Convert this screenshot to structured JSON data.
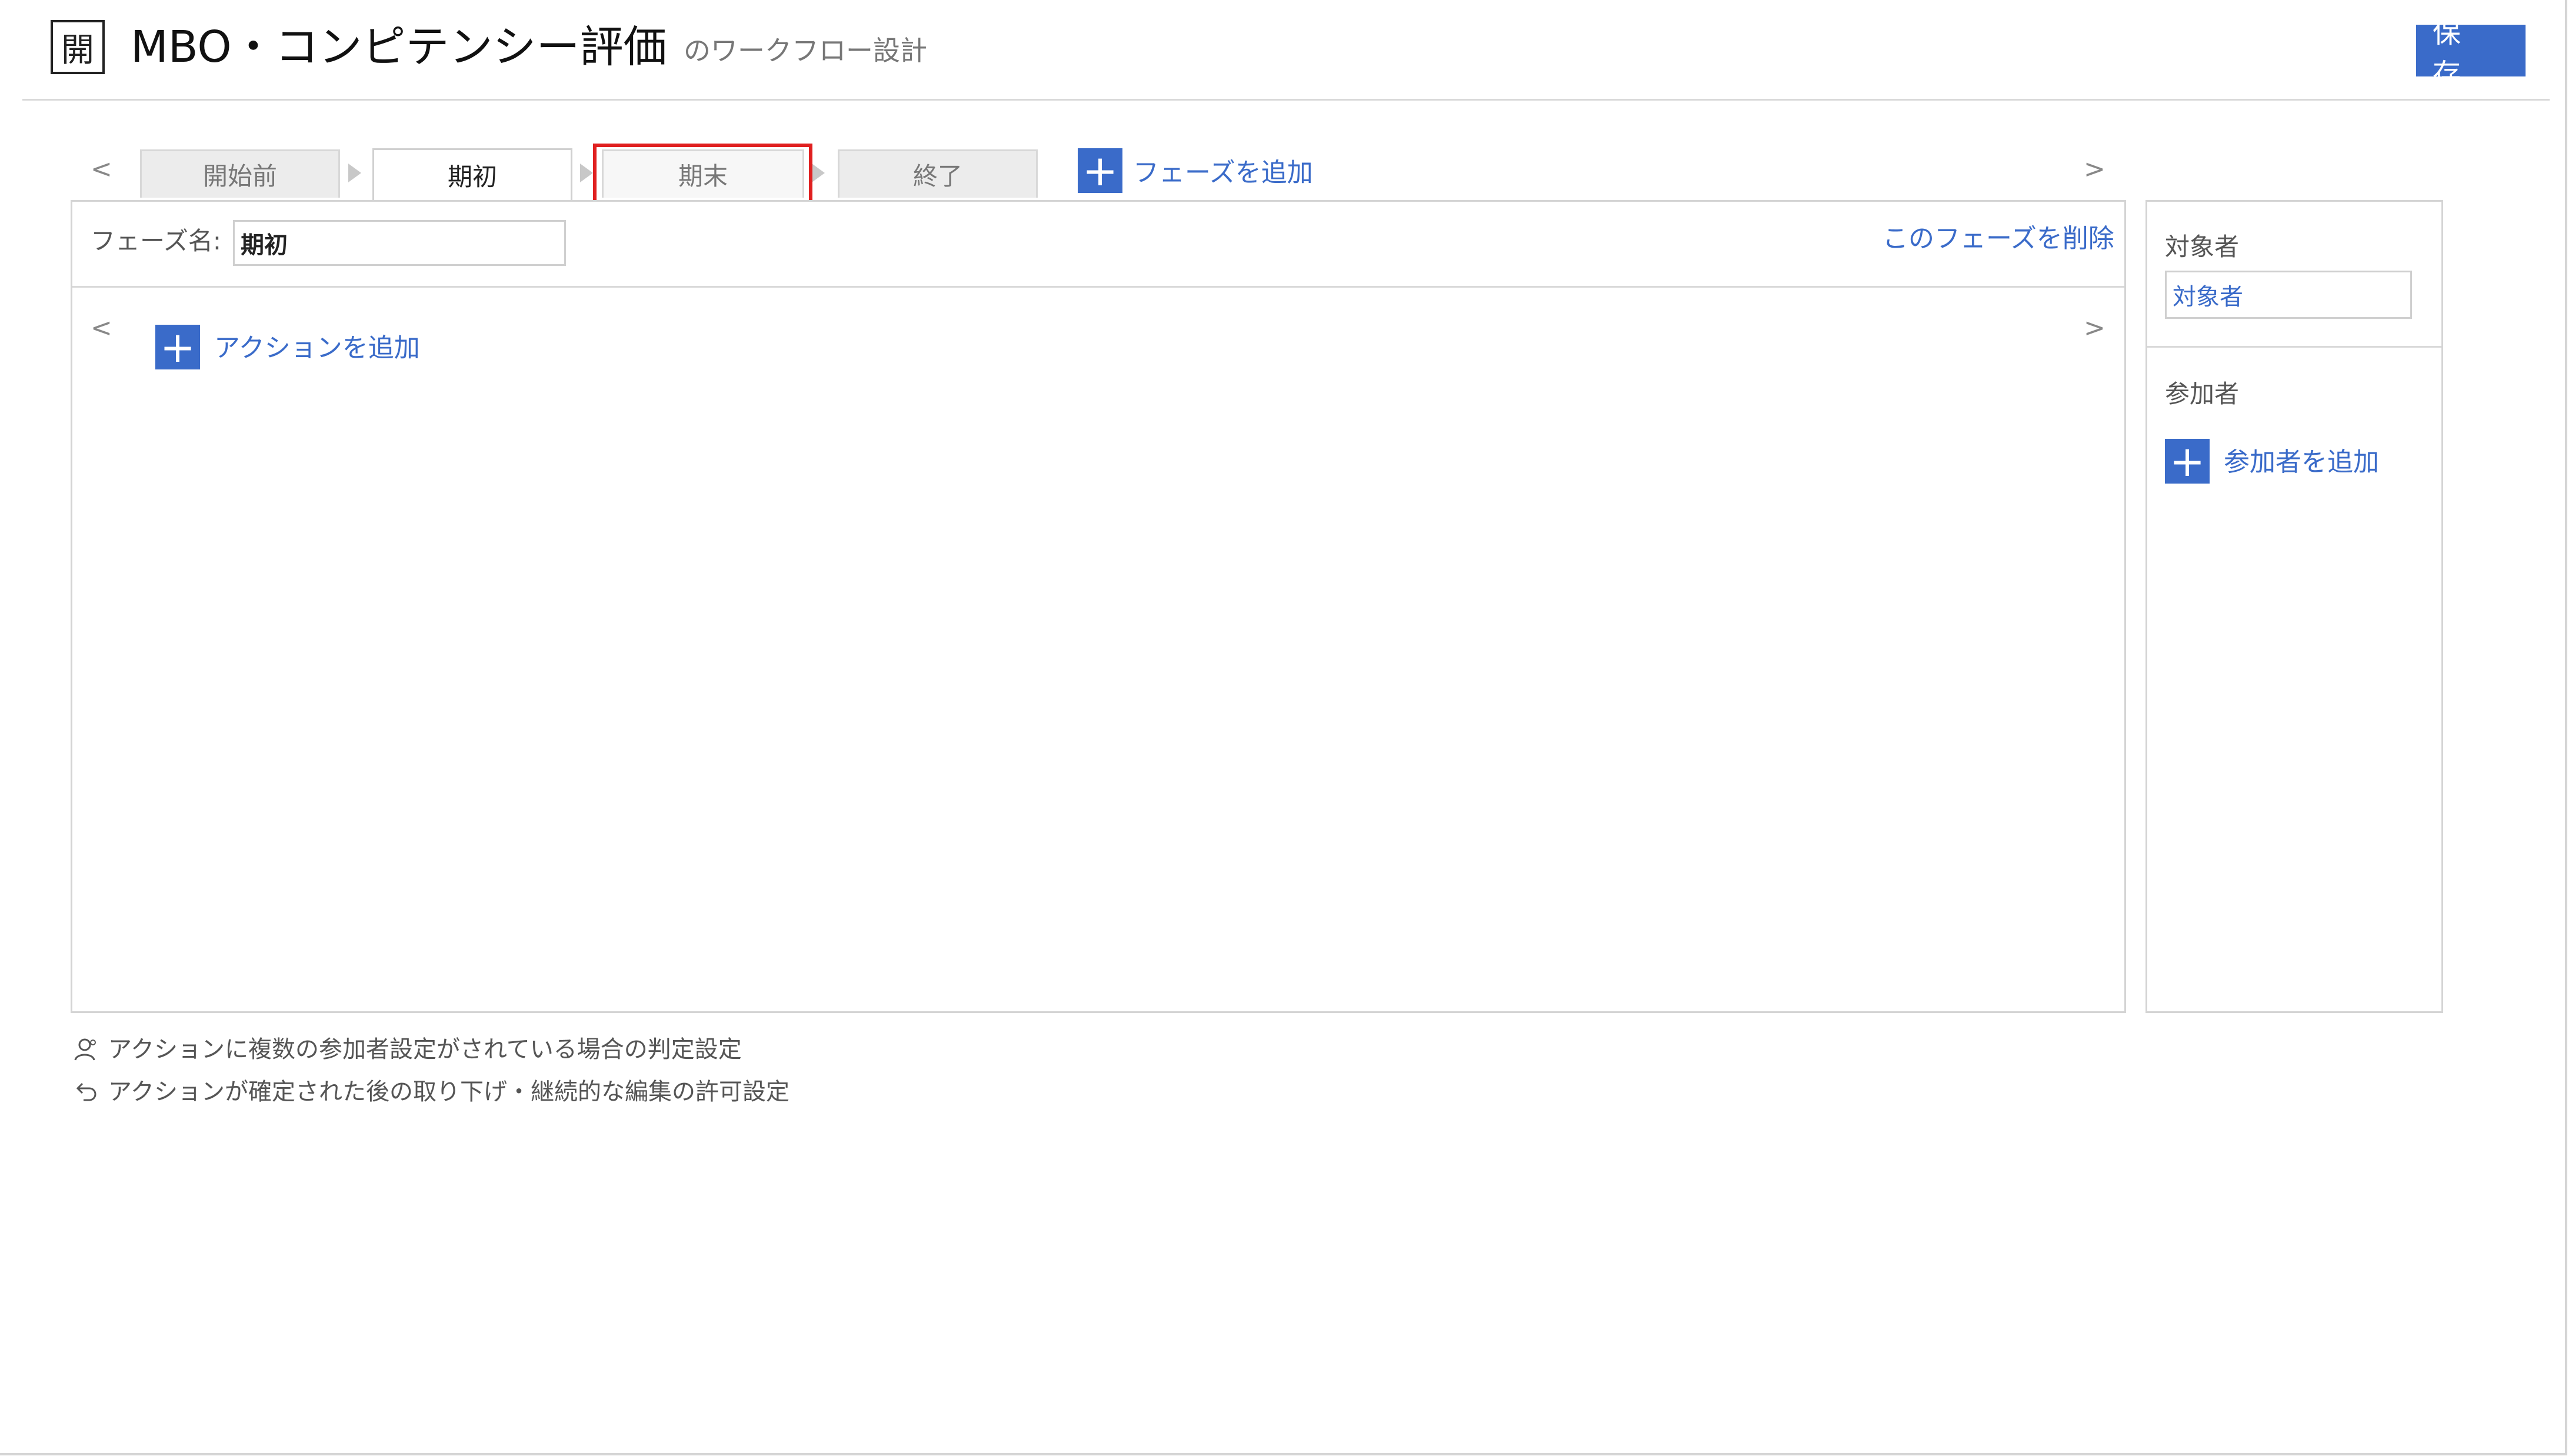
{
  "header": {
    "icon_char": "開",
    "title": "MBO・コンピテンシー評価",
    "subtitle": "のワークフロー設計",
    "save_label": "保 存"
  },
  "phases": {
    "prev_arrow": "<",
    "next_arrow": ">",
    "tabs": [
      "開始前",
      "期初",
      "期末",
      "終了"
    ],
    "active_tab": "期初",
    "highlighted_tab": "期末",
    "add_phase_label": "フェーズを追加"
  },
  "phase_panel": {
    "name_label": "フェーズ名:",
    "name_value": "期初",
    "delete_label": "このフェーズを削除",
    "actions_prev": "<",
    "actions_next": ">",
    "add_action_label": "アクションを追加"
  },
  "side_panel": {
    "target_label": "対象者",
    "target_value": "対象者",
    "participants_label": "参加者",
    "add_participant_label": "参加者を追加"
  },
  "notes": [
    "アクションに複数の参加者設定がされている場合の判定設定",
    "アクションが確定された後の取り下げ・継続的な編集の許可設定"
  ],
  "colors": {
    "accent": "#3a6bc9",
    "highlight": "#e02020"
  }
}
